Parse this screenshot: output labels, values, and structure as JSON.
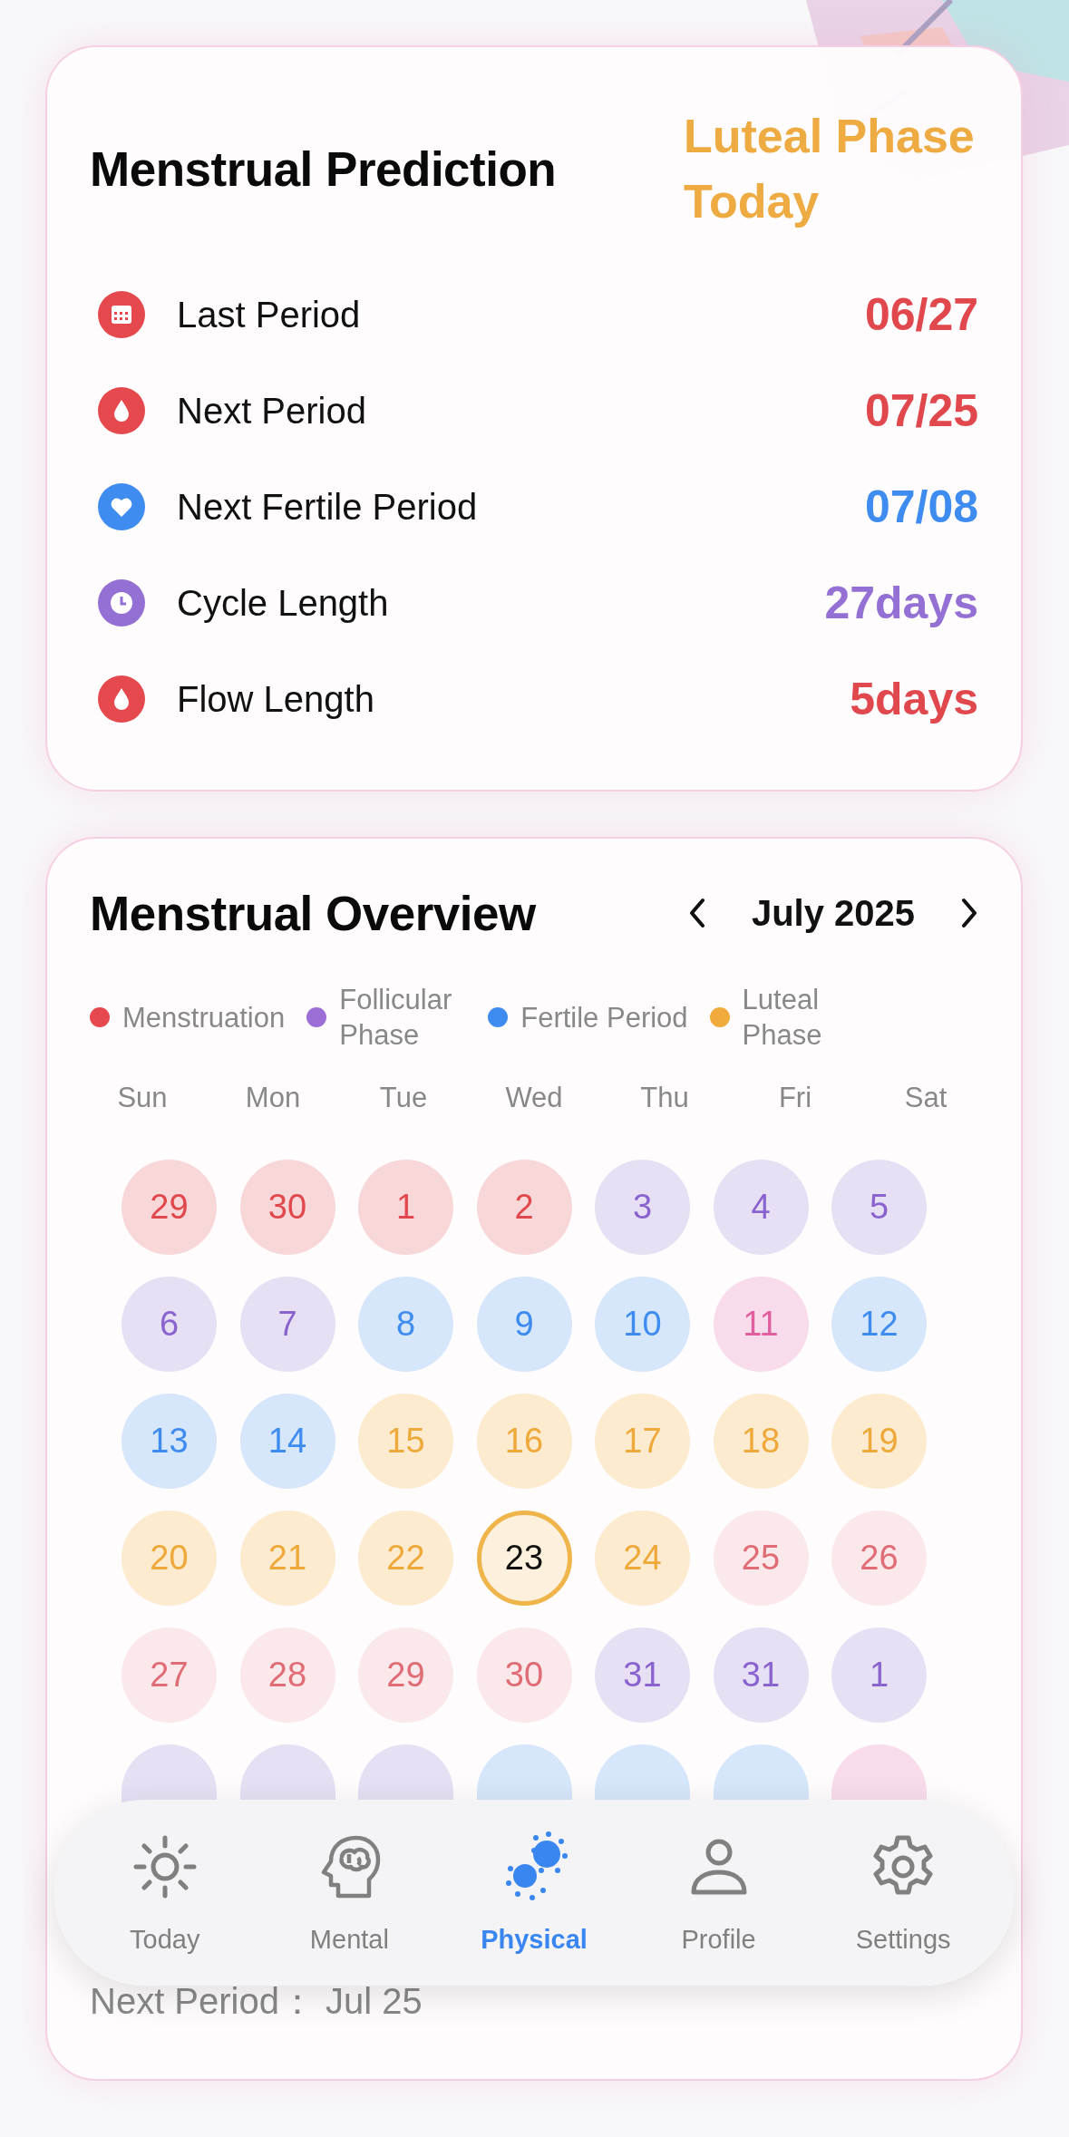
{
  "prediction": {
    "title": "Menstrual Prediction",
    "phase": "Luteal Phase Today",
    "rows": [
      {
        "kind": "calendar",
        "label": "Last Period",
        "value": "06/27",
        "color": "#e0484d"
      },
      {
        "kind": "drop",
        "label": "Next Period",
        "value": "07/25",
        "color": "#e0484d"
      },
      {
        "kind": "heart",
        "label": "Next Fertile Period",
        "value": "07/08",
        "color": "#3f8cf0"
      },
      {
        "kind": "clock",
        "label": "Cycle Length",
        "value": "27days",
        "color": "#9470d4"
      },
      {
        "kind": "drop",
        "label": "Flow Length",
        "value": "5days",
        "color": "#e0484d"
      }
    ]
  },
  "overview": {
    "title": "Menstrual Overview",
    "month": "July 2025",
    "legend": [
      {
        "label": "Menstruation",
        "color": "#e5484d"
      },
      {
        "label": "Follicular Phase",
        "color": "#9b6fd6"
      },
      {
        "label": "Fertile Period",
        "color": "#3f8cf0"
      },
      {
        "label": "Luteal Phase",
        "color": "#f0ab3c"
      }
    ],
    "weekdays": [
      "Sun",
      "Mon",
      "Tue",
      "Wed",
      "Thu",
      "Fri",
      "Sat"
    ],
    "days": [
      {
        "day": "29",
        "kind": "menstruation",
        "selected": false
      },
      {
        "day": "30",
        "kind": "menstruation",
        "selected": false
      },
      {
        "day": "1",
        "kind": "menstruation",
        "selected": false
      },
      {
        "day": "2",
        "kind": "menstruation",
        "selected": false
      },
      {
        "day": "3",
        "kind": "follicular",
        "selected": false
      },
      {
        "day": "4",
        "kind": "follicular",
        "selected": false
      },
      {
        "day": "5",
        "kind": "follicular",
        "selected": false
      },
      {
        "day": "6",
        "kind": "follicular",
        "selected": false
      },
      {
        "day": "7",
        "kind": "follicular",
        "selected": false
      },
      {
        "day": "8",
        "kind": "fertile",
        "selected": false
      },
      {
        "day": "9",
        "kind": "fertile",
        "selected": false
      },
      {
        "day": "10",
        "kind": "fertile",
        "selected": false
      },
      {
        "day": "11",
        "kind": "ovulation",
        "selected": false
      },
      {
        "day": "12",
        "kind": "fertile",
        "selected": false
      },
      {
        "day": "13",
        "kind": "fertile",
        "selected": false
      },
      {
        "day": "14",
        "kind": "fertile",
        "selected": false
      },
      {
        "day": "15",
        "kind": "luteal",
        "selected": false
      },
      {
        "day": "16",
        "kind": "luteal",
        "selected": false
      },
      {
        "day": "17",
        "kind": "luteal",
        "selected": false
      },
      {
        "day": "18",
        "kind": "luteal",
        "selected": false
      },
      {
        "day": "19",
        "kind": "luteal",
        "selected": false
      },
      {
        "day": "20",
        "kind": "luteal",
        "selected": false
      },
      {
        "day": "21",
        "kind": "luteal",
        "selected": false
      },
      {
        "day": "22",
        "kind": "luteal",
        "selected": false
      },
      {
        "day": "23",
        "kind": "luteal",
        "selected": true
      },
      {
        "day": "24",
        "kind": "luteal",
        "selected": false
      },
      {
        "day": "25",
        "kind": "predicted",
        "selected": false
      },
      {
        "day": "26",
        "kind": "predicted",
        "selected": false
      },
      {
        "day": "27",
        "kind": "predicted",
        "selected": false
      },
      {
        "day": "28",
        "kind": "predicted",
        "selected": false
      },
      {
        "day": "29",
        "kind": "predicted",
        "selected": false
      },
      {
        "day": "30",
        "kind": "predicted",
        "selected": false
      },
      {
        "day": "31",
        "kind": "follicular",
        "selected": false
      },
      {
        "day": "31",
        "kind": "follicular",
        "selected": false
      },
      {
        "day": "1",
        "kind": "follicular",
        "selected": false
      },
      {
        "kind": "follicular",
        "selected": false
      },
      {
        "kind": "follicular",
        "selected": false
      },
      {
        "kind": "follicular",
        "selected": false
      },
      {
        "kind": "fertile",
        "selected": false
      },
      {
        "kind": "fertile",
        "selected": false
      },
      {
        "kind": "fertile",
        "selected": false
      },
      {
        "kind": "ovulation",
        "selected": false
      }
    ],
    "next_period": "Next Period：  Jul 25"
  },
  "nav": [
    {
      "kind": "sun",
      "label": "Today",
      "selected": false
    },
    {
      "kind": "brain",
      "label": "Mental",
      "selected": false
    },
    {
      "kind": "cells",
      "label": "Physical",
      "selected": true
    },
    {
      "kind": "person",
      "label": "Profile",
      "selected": false
    },
    {
      "kind": "gear",
      "label": "Settings",
      "selected": false
    }
  ]
}
